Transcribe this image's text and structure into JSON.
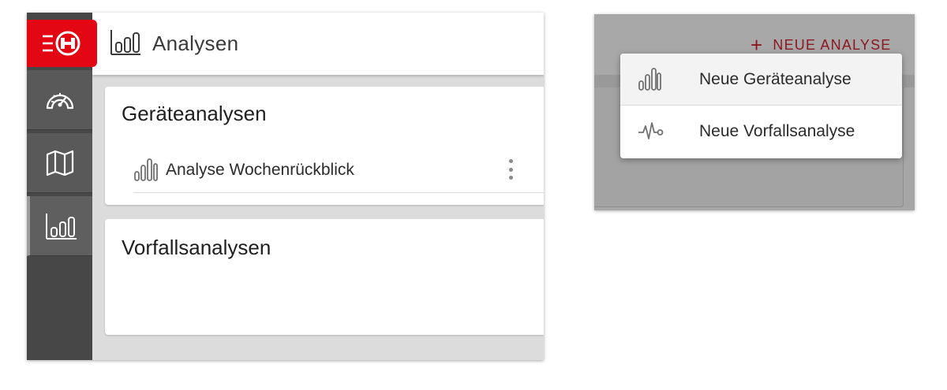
{
  "header": {
    "title": "Analysen"
  },
  "sidebar": {
    "items": [
      {
        "icon": "dashboard-gauge-icon"
      },
      {
        "icon": "map-icon"
      },
      {
        "icon": "bar-chart-icon"
      }
    ]
  },
  "sections": [
    {
      "title": "Geräteanalysen",
      "items": [
        {
          "label": "Analyse Wochenrückblick",
          "icon": "bar-chart-icon"
        }
      ]
    },
    {
      "title": "Vorfallsanalysen",
      "items": []
    }
  ],
  "dropdown": {
    "button_label": "NEUE ANALYSE",
    "button_icon": "plus-icon",
    "items": [
      {
        "label": "Neue Geräteanalyse",
        "icon": "bar-chart-icon"
      },
      {
        "label": "Neue Vorfallsanalyse",
        "icon": "pulse-icon"
      }
    ]
  },
  "colors": {
    "brand_red": "#e30613",
    "accent_dark_red": "#8b1820",
    "sidebar_bg": "#474747"
  }
}
